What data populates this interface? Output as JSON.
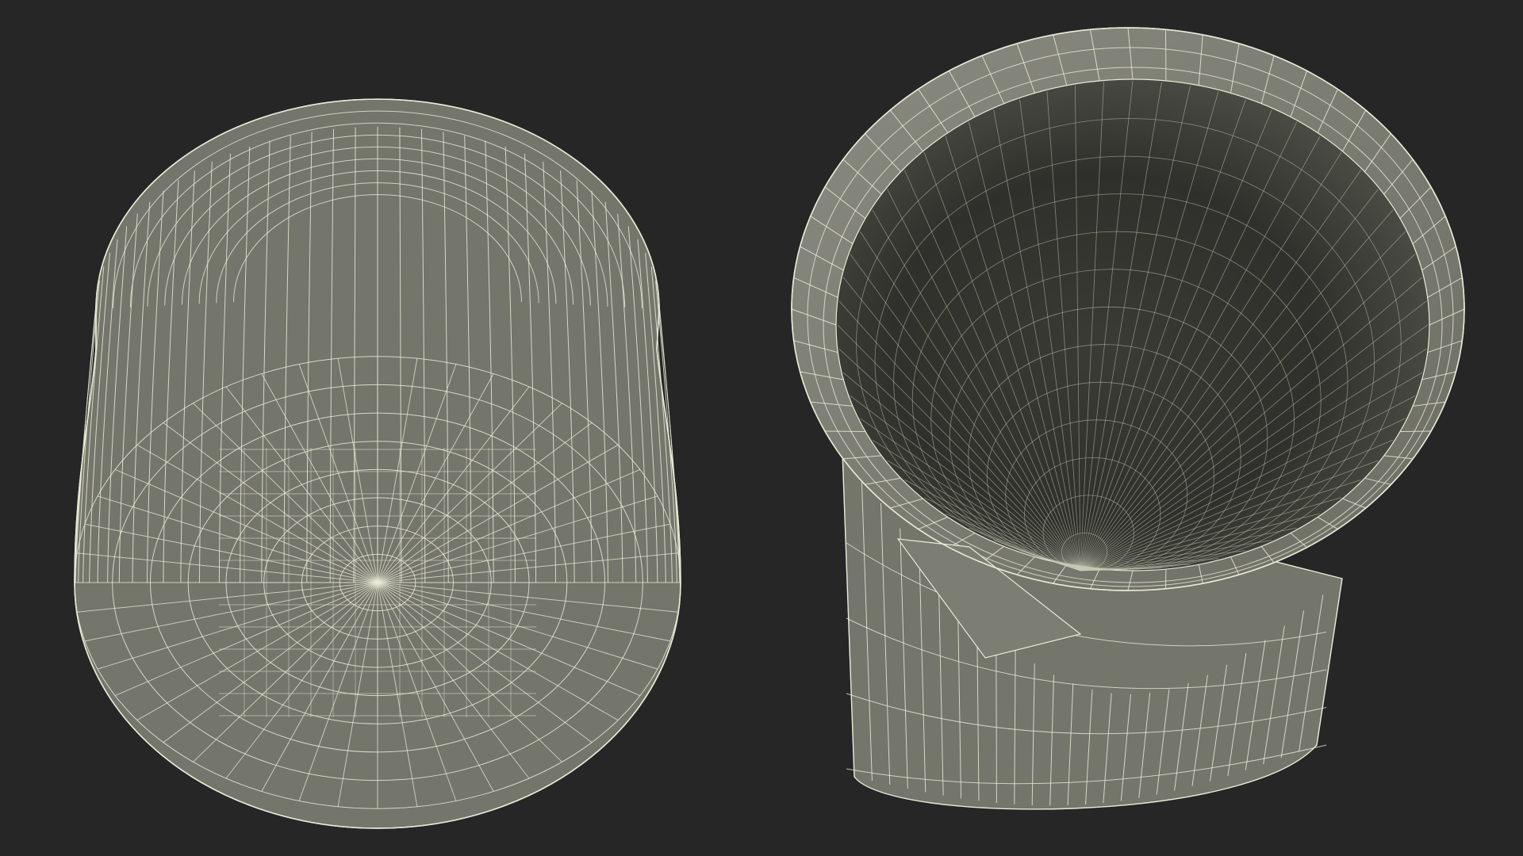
{
  "scene": {
    "background_color": "#262626",
    "mesh_fill_color": "#74756b",
    "mesh_inner_dark_color": "#30312c",
    "wire_color": "#e9ead6",
    "models": [
      {
        "view": "bottom",
        "name": "beaker-bottom-view"
      },
      {
        "view": "top",
        "name": "beaker-top-view"
      }
    ]
  }
}
